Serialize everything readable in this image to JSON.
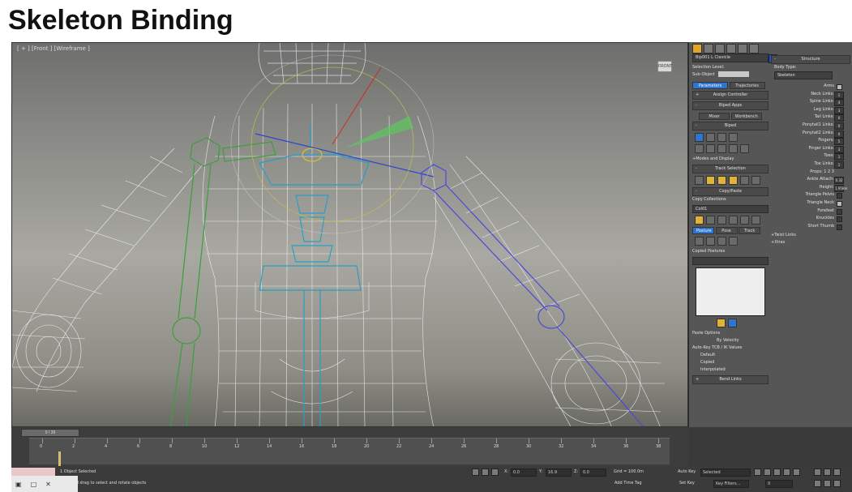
{
  "slide_title": "Skeleton Binding",
  "viewport": {
    "label": "[ + ] [Front ] [Wireframe ]",
    "viewcube_label": "FRONT"
  },
  "command_panel": {
    "object_name": "Bip001 L Clavicle",
    "object_color": "#1e4fd8",
    "selection_level_label": "Selection Level:",
    "sub_object_label": "Sub-Object",
    "parameters_label": "Parameters",
    "trajectories_label": "Trajectories",
    "rollouts": {
      "assign_controller": "Assign Controller",
      "biped_apps": "Biped Apps",
      "biped": "Biped",
      "modes_display": "+Modes and Display",
      "track_selection": "Track Selection",
      "copy_paste": "Copy/Paste",
      "bend_links": "Bend Links"
    },
    "mixer_label": "Mixer",
    "workbench_label": "Workbench",
    "copy_collections_label": "Copy Collections",
    "collection_value": "Col01",
    "posture_label": "Posture",
    "pose_label": "Pose",
    "track_label": "Track",
    "copied_postures_label": "Copied Postures",
    "paste_options_label": "Paste Options",
    "by_velocity_label": "By Velocity",
    "auto_key_tcb_label": "Auto-Key TCB / IK Values",
    "radio_default": "Default",
    "radio_copied": "Copied",
    "radio_interpolated": "Interpolated"
  },
  "structure": {
    "title": "Structure",
    "body_type_label": "Body Type:",
    "body_type_value": "Skeleton",
    "rows": [
      {
        "label": "Arms",
        "kind": "check",
        "checked": true
      },
      {
        "label": "Neck Links:",
        "kind": "num",
        "value": "1"
      },
      {
        "label": "Spine Links:",
        "kind": "num",
        "value": "4"
      },
      {
        "label": "Leg Links:",
        "kind": "num",
        "value": "3"
      },
      {
        "label": "Tail Links:",
        "kind": "num",
        "value": "0"
      },
      {
        "label": "Ponytail1 Links:",
        "kind": "num",
        "value": "0"
      },
      {
        "label": "Ponytail2 Links:",
        "kind": "num",
        "value": "0"
      },
      {
        "label": "Fingers:",
        "kind": "num",
        "value": "5"
      },
      {
        "label": "Finger Links:",
        "kind": "num",
        "value": "3"
      },
      {
        "label": "Toes:",
        "kind": "num",
        "value": "1"
      },
      {
        "label": "Toe Links:",
        "kind": "num",
        "value": "1"
      },
      {
        "label": "Props: 1 2 3",
        "kind": "plain"
      },
      {
        "label": "Ankle Attach:",
        "kind": "num",
        "value": "0.32"
      },
      {
        "label": "Height:",
        "kind": "num",
        "value": "1.958m"
      },
      {
        "label": "Triangle Pelvis",
        "kind": "check",
        "checked": false
      },
      {
        "label": "Triangle Neck",
        "kind": "check",
        "checked": true
      },
      {
        "label": "Forefeet",
        "kind": "check",
        "checked": false
      },
      {
        "label": "Knuckles",
        "kind": "check",
        "checked": false
      },
      {
        "label": "Short Thumb",
        "kind": "check",
        "checked": false
      }
    ],
    "twist_links_label": "+Twist Links",
    "xtras_label": "+Xtras"
  },
  "timeline": {
    "slider_label": "0 / 39",
    "ticks": [
      "0",
      "2",
      "4",
      "6",
      "8",
      "10",
      "12",
      "14",
      "16",
      "18",
      "20",
      "22",
      "24",
      "26",
      "28",
      "30",
      "32",
      "34",
      "36",
      "38"
    ]
  },
  "status_bar": {
    "selection_info": "1 Object Selected",
    "prompt": "Click and drag to select and rotate objects",
    "x_label": "X:",
    "x_value": "0.0",
    "y_label": "Y:",
    "y_value": "16.9",
    "z_label": "Z:",
    "z_value": "0.0",
    "grid_label": "Grid = 100.0m",
    "add_time_tag": "Add Time Tag",
    "auto_key": "Auto Key",
    "selected_value": "Selected",
    "set_key": "Set Key",
    "key_filters": "Key Filters...",
    "frame_value": "0"
  }
}
